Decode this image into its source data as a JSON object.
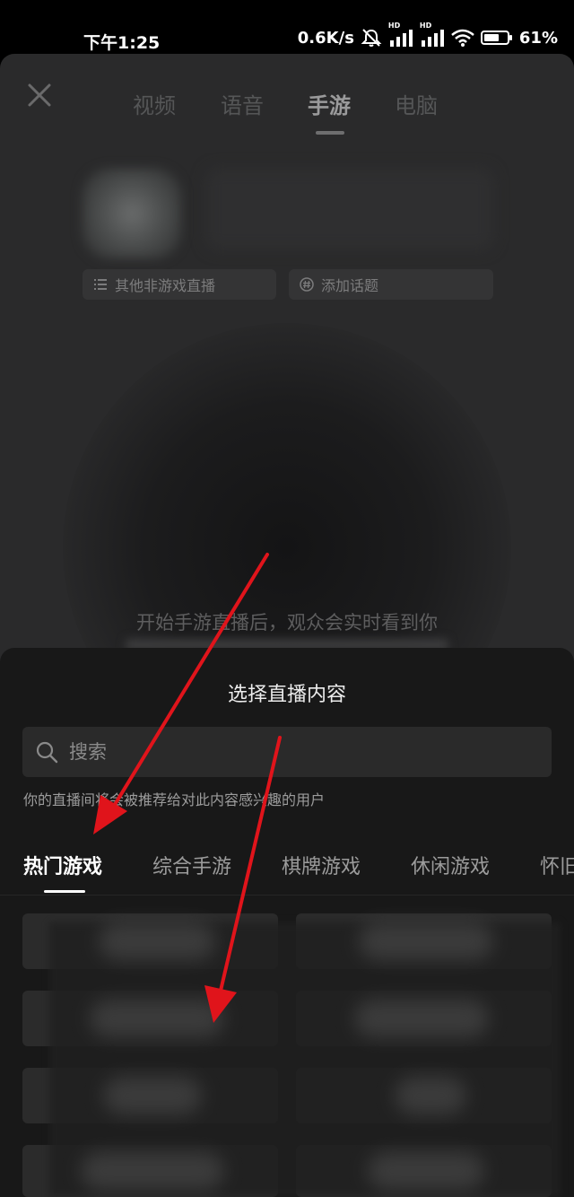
{
  "status_bar": {
    "time": "下午1:25",
    "speed": "0.6K/s",
    "hd1": "HD",
    "hd2": "HD",
    "battery": "61%"
  },
  "live_page": {
    "tabs": [
      {
        "label": "视频",
        "active": false
      },
      {
        "label": "语音",
        "active": false
      },
      {
        "label": "手游",
        "active": true
      },
      {
        "label": "电脑",
        "active": false
      }
    ],
    "chip_category": "其他非游戏直播",
    "chip_topic": "添加话题",
    "hint": "开始手游直播后，观众会实时看到你"
  },
  "sheet": {
    "title": "选择直播内容",
    "search_placeholder": "搜索",
    "note": "你的直播间将会被推荐给对此内容感兴趣的用户",
    "categories": [
      {
        "label": "热门游戏",
        "active": true
      },
      {
        "label": "综合手游",
        "active": false
      },
      {
        "label": "棋牌游戏",
        "active": false
      },
      {
        "label": "休闲游戏",
        "active": false
      },
      {
        "label": "怀旧",
        "active": false
      }
    ]
  },
  "colors": {
    "annotation_arrow": "#e0141b",
    "sheet_bg": "#181818",
    "page_bg": "#2a2a2b"
  }
}
